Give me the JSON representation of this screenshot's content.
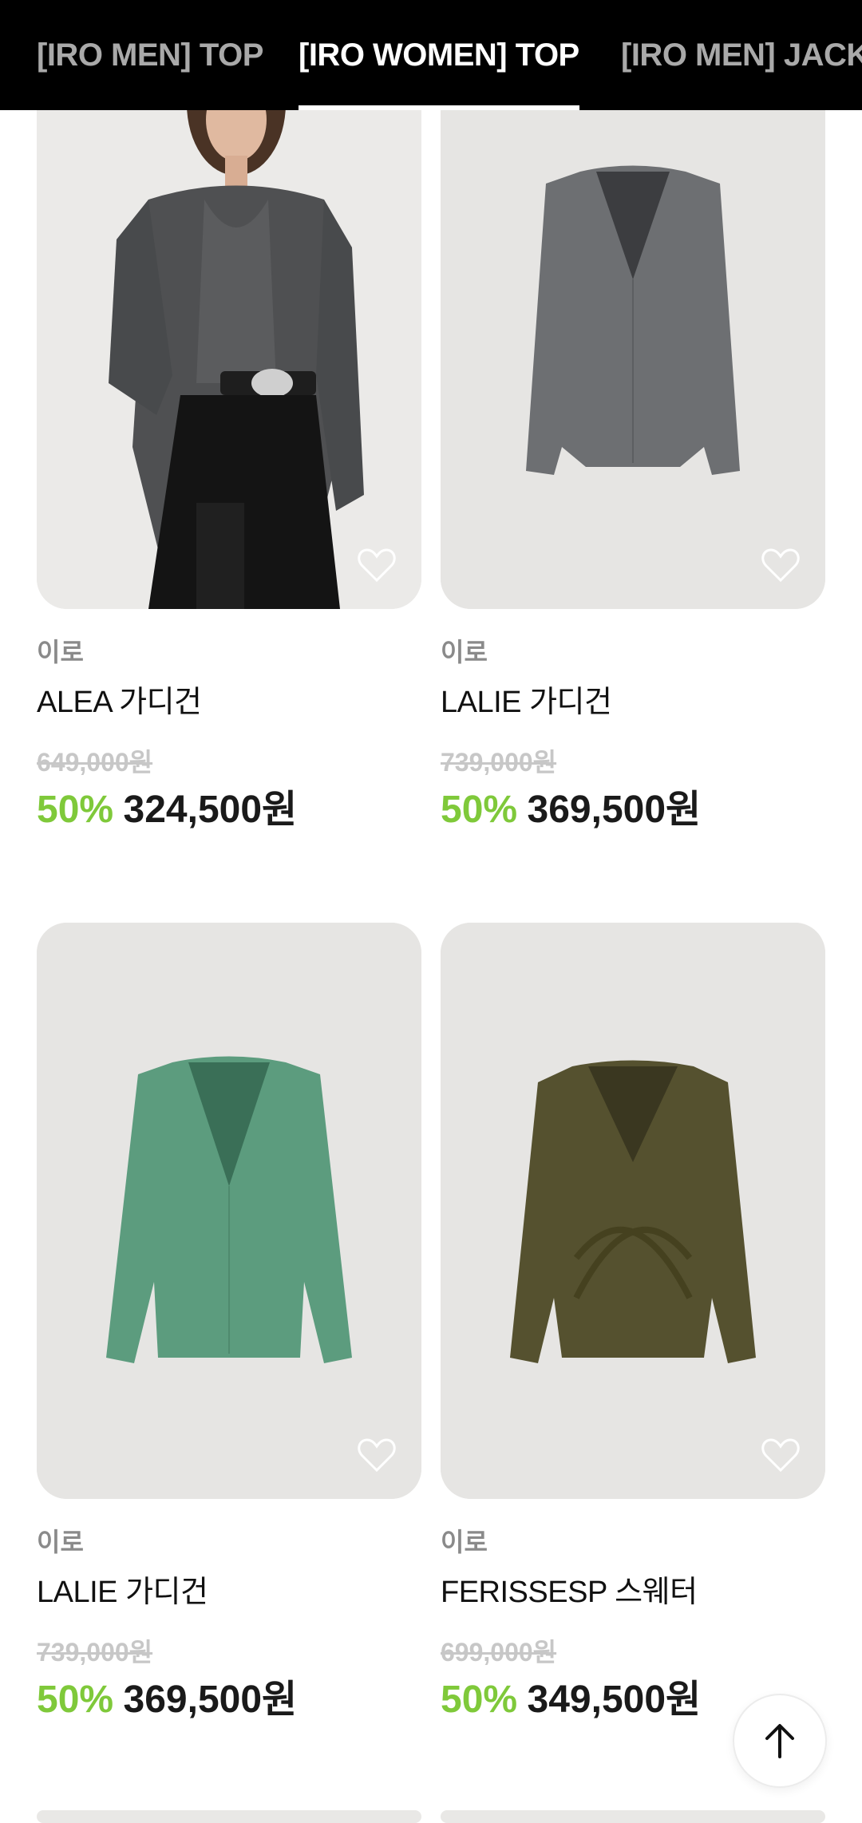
{
  "tabs": [
    {
      "label": "[IRO MEN] TOP",
      "active": false
    },
    {
      "label": "[IRO WOMEN] TOP",
      "active": true
    },
    {
      "label": "[IRO MEN] JACKET",
      "active": false
    }
  ],
  "products": [
    {
      "brand": "이로",
      "name": "ALEA 가디건",
      "original_price": "649,000원",
      "discount": "50%",
      "price": "324,500원",
      "image": "model wearing grey knit cardigan"
    },
    {
      "brand": "이로",
      "name": "LALIE 가디건",
      "original_price": "739,000원",
      "discount": "50%",
      "price": "369,500원",
      "image": "grey v-neck cardigan"
    },
    {
      "brand": "이로",
      "name": "LALIE 가디건",
      "original_price": "739,000원",
      "discount": "50%",
      "price": "369,500원",
      "image": "green v-neck cardigan"
    },
    {
      "brand": "이로",
      "name": "FERISSESP 스웨터",
      "original_price": "699,000원",
      "discount": "50%",
      "price": "349,500원",
      "image": "olive twisted knit sweater"
    }
  ],
  "colors": {
    "discount": "#7fc93a",
    "tabbar_bg": "#000000",
    "card_bg": "#e9e8e6"
  },
  "icons": {
    "wishlist": "heart-icon",
    "scroll_top": "arrow-up-icon"
  }
}
